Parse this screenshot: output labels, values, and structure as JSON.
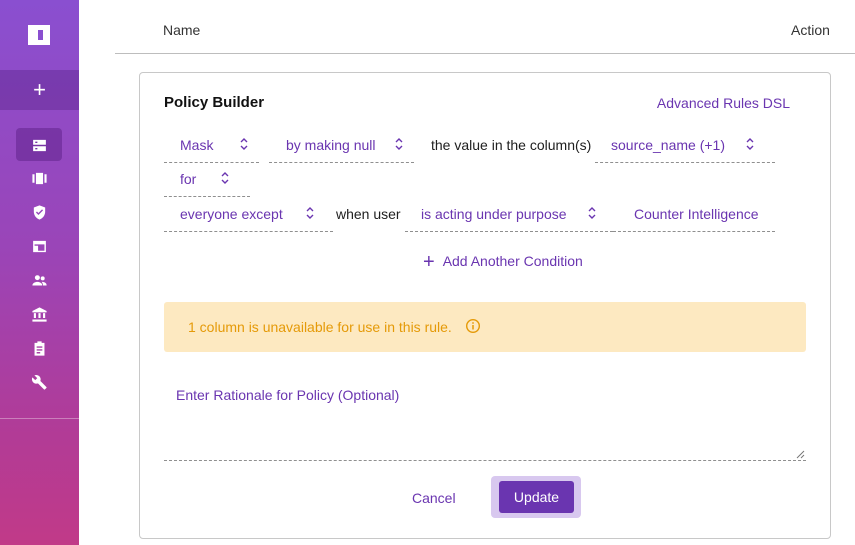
{
  "sidebar": {
    "add_label": "+",
    "items": [
      {
        "name": "data-sources-icon"
      },
      {
        "name": "projects-icon"
      },
      {
        "name": "policies-shield-icon"
      },
      {
        "name": "browser-window-icon"
      },
      {
        "name": "users-icon"
      },
      {
        "name": "governance-bank-icon"
      },
      {
        "name": "audit-clipboard-icon"
      },
      {
        "name": "settings-wrench-icon"
      }
    ]
  },
  "table": {
    "col_name": "Name",
    "col_action": "Action"
  },
  "policy_builder": {
    "title": "Policy Builder",
    "advanced_link": "Advanced Rules DSL",
    "rule": {
      "action": "Mask",
      "method": "by making null",
      "column_text": "the value in the column(s)",
      "columns": "source_name (+1)",
      "for": "for",
      "subjects": "everyone except",
      "when_user": "when user",
      "condition": "is acting under purpose",
      "purpose": "Counter Intelligence"
    },
    "add_condition": "Add Another Condition",
    "warning": "1 column is unavailable for use in this rule.",
    "rationale_placeholder": "Enter Rationale for Policy (Optional)",
    "cancel": "Cancel",
    "update": "Update"
  },
  "colors": {
    "accent": "#6a35b0",
    "warning_bg": "#fde9c1",
    "warning_text": "#e59a08"
  }
}
